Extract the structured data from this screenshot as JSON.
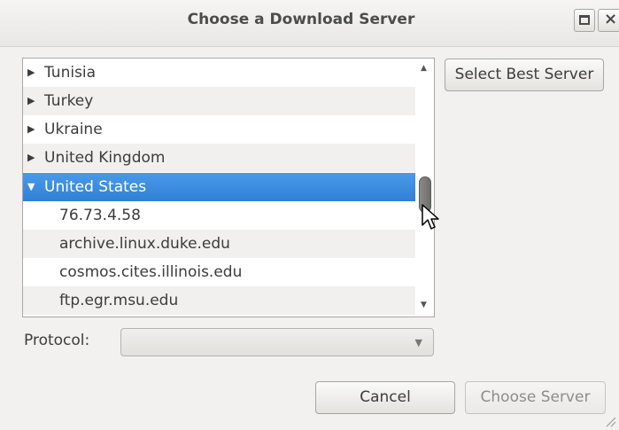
{
  "window": {
    "title": "Choose a Download Server",
    "maximize_icon": "maximize-icon",
    "close_symbol": "×"
  },
  "server_list": {
    "rows": [
      {
        "label": "Tunisia",
        "expander": "▶"
      },
      {
        "label": "Turkey",
        "expander": "▶"
      },
      {
        "label": "Ukraine",
        "expander": "▶"
      },
      {
        "label": "United Kingdom",
        "expander": "▶"
      },
      {
        "label": "United States",
        "expander": "▼",
        "selected": true
      },
      {
        "label": "76.73.4.58"
      },
      {
        "label": "archive.linux.duke.edu"
      },
      {
        "label": "cosmos.cites.illinois.edu"
      },
      {
        "label": "ftp.egr.msu.edu"
      }
    ],
    "scroll_up_symbol": "▲",
    "scroll_down_symbol": "▼"
  },
  "buttons": {
    "select_best": "Select Best Server",
    "cancel": "Cancel",
    "choose": "Choose Server"
  },
  "protocol": {
    "label": "Protocol:",
    "value": "",
    "caret": "▼"
  },
  "colors": {
    "selection": "#3d8ee2",
    "window_bg": "#f2f1f0"
  }
}
